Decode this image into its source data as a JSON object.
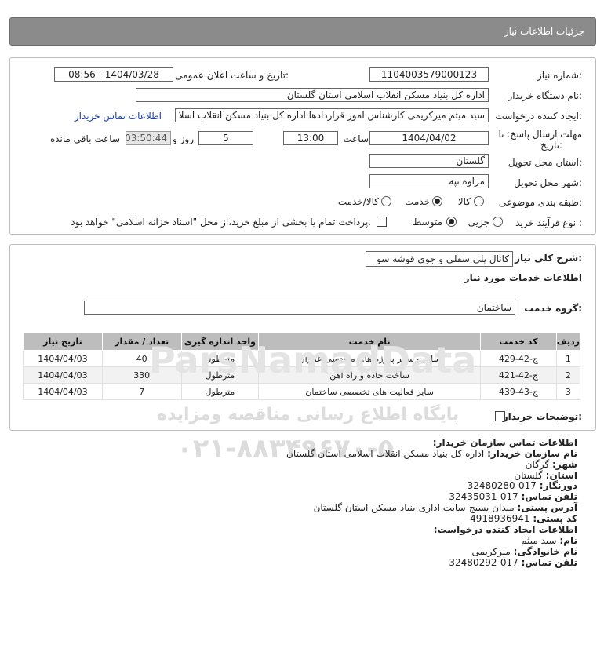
{
  "header": {
    "title": "جزئیات اطلاعات نیاز"
  },
  "form": {
    "need_number_label": "شماره نیاز:",
    "need_number": "1104003579000123",
    "announce_label": "تاریخ و ساعت اعلان عمومی:",
    "announce_value": "1404/03/28 - 08:56",
    "buyer_org_label": "نام دستگاه خریدار:",
    "buyer_org": "اداره کل بنیاد مسکن انقلاب اسلامی استان گلستان",
    "creator_label": "ایجاد کننده درخواست:",
    "creator": "سید میثم میرکریمی کارشناس امور قراردادها اداره کل بنیاد مسکن انقلاب اسلا",
    "contact_link": "اطلاعات تماس خریدار",
    "deadline_label_1": "مهلت ارسال پاسخ: تا",
    "deadline_label_2": "تاریخ:",
    "deadline_date": "1404/04/02",
    "time_label": "ساعت",
    "deadline_time": "13:00",
    "days_value": "5",
    "days_label": "روز و",
    "remaining_time": "03:50:44",
    "remaining_label": "ساعت باقی مانده",
    "province_label": "استان محل تحویل:",
    "province": "گلستان",
    "city_label": "شهر محل تحویل:",
    "city": "مراوه تپه",
    "category_label": "طبقه بندی موضوعی:",
    "category_options": [
      "کالا",
      "خدمت",
      "کالا/خدمت"
    ],
    "category_selected": "خدمت",
    "process_label": "نوع فرآیند خرید :",
    "process_options": [
      "جزیی",
      "متوسط"
    ],
    "process_selected": "متوسط",
    "payment_note": "پرداخت تمام یا بخشی از مبلغ خرید،از محل \"اسناد خزانه اسلامی\" خواهد بود."
  },
  "description": {
    "label": "شرح کلی نیاز:",
    "value": "کانال پلی سفلی و جوی قوشه سو",
    "services_heading": "اطلاعات خدمات مورد نیاز",
    "service_group_label": "گروه خدمت:",
    "service_group": "ساختمان"
  },
  "table": {
    "headers": [
      "ردیف",
      "کد خدمت",
      "نام خدمت",
      "واحد اندازه گیری",
      "تعداد / مقدار",
      "تاریخ نیاز"
    ],
    "rows": [
      {
        "row": "1",
        "code": "ج-42-429",
        "name": "ساخت سایر پروژه های مهندسی عمران",
        "unit": "مترطول",
        "qty": "40",
        "date": "1404/04/03"
      },
      {
        "row": "2",
        "code": "ج-42-421",
        "name": "ساخت جاده و راه آهن",
        "unit": "مترطول",
        "qty": "330",
        "date": "1404/04/03"
      },
      {
        "row": "3",
        "code": "ج-43-439",
        "name": "سایر فعالیت های تخصصی ساختمان",
        "unit": "مترطول",
        "qty": "7",
        "date": "1404/04/03"
      }
    ],
    "buyer_notes_label": "توضیحات خریدار:"
  },
  "contact": {
    "heading": "اطلاعات تماس سازمان خریدار:",
    "org_label": "نام سازمان خریدار:",
    "org": "اداره کل بنیاد مسکن انقلاب اسلامی استان گلستان",
    "city_label": "شهر:",
    "city": "گرگان",
    "province_label": "استان:",
    "province": "گلستان",
    "fax_label": "دورنگار:",
    "fax": "017-32480280",
    "phone_label": "تلفن تماس:",
    "phone": "017-32435031",
    "address_label": "آدرس پستی:",
    "address": "میدان بسیج-سایت اداری-بنیاد مسکن استان گلستان",
    "postal_label": "کد پستی:",
    "postal": "4918936941",
    "creator_heading": "اطلاعات ایجاد کننده درخواست:",
    "first_name_label": "نام:",
    "first_name": "سید میثم",
    "last_name_label": "نام خانوادگی:",
    "last_name": "میرکریمی",
    "creator_phone_label": "تلفن تماس:",
    "creator_phone": "017-32480292"
  },
  "watermark": {
    "line1": "ParsNamadData",
    "line2": "پایگاه اطلاع رسانی مناقصه ومزایده",
    "line3": "۰۲۱-۸۸۳۴۹۶۷۰-۵"
  },
  "colors": {
    "header_bg": "#8b8b8b",
    "link": "#1a3fa8",
    "table_header_bg": "#bdbdbd"
  }
}
